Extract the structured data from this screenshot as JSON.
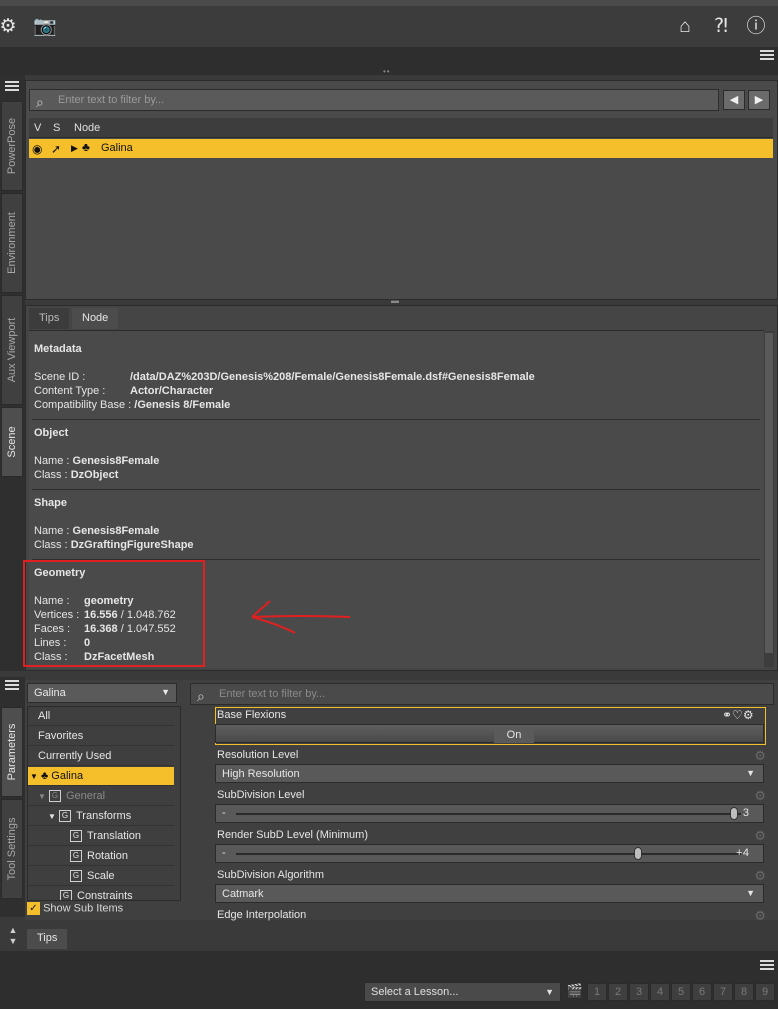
{
  "scene": {
    "filter_placeholder": "Enter text to filter by...",
    "columns": [
      "V",
      "S",
      "Node"
    ],
    "node_name": "Galina"
  },
  "side_tabs": [
    "PowerPose",
    "Environment",
    "Aux Viewport",
    "Scene"
  ],
  "info": {
    "tabs": [
      "Tips",
      "Node"
    ],
    "sections": {
      "metadata": {
        "title": "Metadata",
        "scene_id_label": "Scene ID :",
        "scene_id": "/data/DAZ%203D/Genesis%208/Female/Genesis8Female.dsf#Genesis8Female",
        "content_type_label": "Content Type :",
        "content_type": "Actor/Character",
        "compat_label": "Compatibility Base :",
        "compat": "/Genesis 8/Female"
      },
      "object": {
        "title": "Object",
        "name_label": "Name :",
        "name": "Genesis8Female",
        "class_label": "Class :",
        "class": "DzObject"
      },
      "shape": {
        "title": "Shape",
        "name_label": "Name :",
        "name": "Genesis8Female",
        "class_label": "Class :",
        "class": "DzGraftingFigureShape"
      },
      "geometry": {
        "title": "Geometry",
        "name_label": "Name :",
        "name": "geometry",
        "vertices_label": "Vertices :",
        "vertices": "16.556",
        "vertices_total": "/ 1.048.762",
        "faces_label": "Faces :",
        "faces": "16.368",
        "faces_total": "/ 1.047.552",
        "lines_label": "Lines :",
        "lines": "0",
        "class_label": "Class :",
        "class": "DzFacetMesh"
      }
    }
  },
  "params_side_tabs": [
    "Parameters",
    "Tool Settings"
  ],
  "params": {
    "node_select": "Galina",
    "filter_placeholder": "Enter text to filter by...",
    "tree": [
      "All",
      "Favorites",
      "Currently Used",
      "Galina",
      "General",
      "Transforms",
      "Translation",
      "Rotation",
      "Scale",
      "Constraints"
    ],
    "show_sub_items": "Show Sub Items",
    "rows": {
      "base_flexions": {
        "label": "Base Flexions",
        "value": "On"
      },
      "resolution_level": {
        "label": "Resolution Level",
        "value": "High Resolution"
      },
      "subdivision_level": {
        "label": "SubDivision Level",
        "value": "3",
        "minus": "-"
      },
      "render_subd": {
        "label": "Render SubD Level (Minimum)",
        "value": "4",
        "minus": "-",
        "plus": "+"
      },
      "subd_algorithm": {
        "label": "SubDivision Algorithm",
        "value": "Catmark"
      },
      "edge_interp": {
        "label": "Edge Interpolation"
      }
    }
  },
  "tips_tab": "Tips",
  "lesson": {
    "select": "Select a Lesson...",
    "numbers": [
      "1",
      "2",
      "3",
      "4",
      "5",
      "6",
      "7",
      "8",
      "9"
    ]
  },
  "colors": {
    "selection": "#f4bf2b",
    "annotation": "#e02020"
  }
}
